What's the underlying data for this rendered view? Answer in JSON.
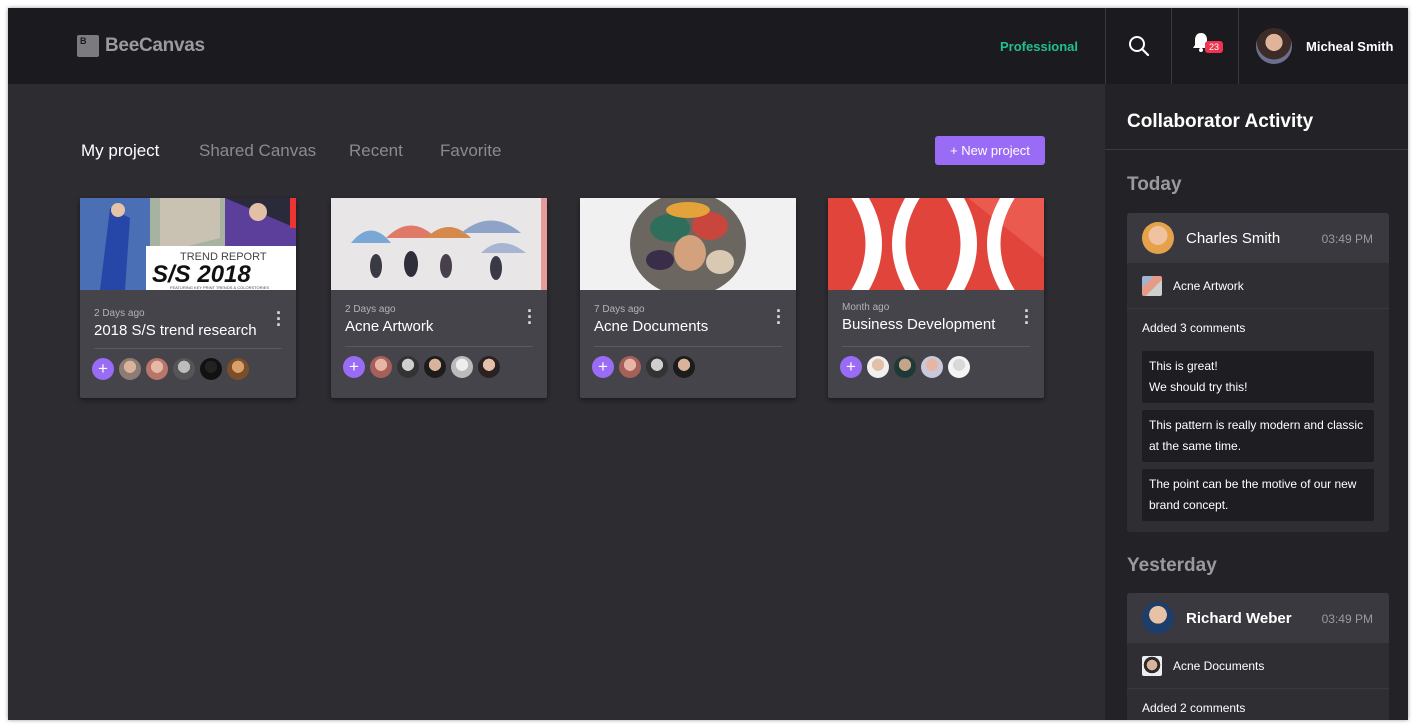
{
  "header": {
    "logo_text": "BeeCanvas",
    "logo_letter": "B",
    "plan": "Professional",
    "notification_count": "23",
    "user_name": "Micheal Smith"
  },
  "tabs": [
    {
      "label": "My project",
      "active": true
    },
    {
      "label": "Shared Canvas",
      "active": false
    },
    {
      "label": "Recent",
      "active": false
    },
    {
      "label": "Favorite",
      "active": false
    }
  ],
  "new_project_label": "+ New project",
  "projects": [
    {
      "time": "2 Days ago",
      "title": "2018 S/S trend research",
      "thumb_text_1": "TREND REPORT",
      "thumb_text_2": "S/S 2018",
      "thumb_text_3": "FEATURING KEY PRINT TRENDS & COLORSTORIES"
    },
    {
      "time": "2 Days ago",
      "title": "Acne Artwork"
    },
    {
      "time": "7 Days ago",
      "title": "Acne Documents"
    },
    {
      "time": "Month ago",
      "title": "Business Development"
    }
  ],
  "panel": {
    "title": "Collaborator Activity",
    "today_label": "Today",
    "yesterday_label": "Yesterday",
    "activities": [
      {
        "name": "Charles Smith",
        "time": "03:49 PM",
        "file": "Acne Artwork",
        "summary": "Added 3 comments",
        "comments": [
          "This is great!\nWe should try this!",
          "This pattern is really modern and classic at the same time.",
          "The point can be the motive of our new brand concept."
        ]
      },
      {
        "name": "Richard Weber",
        "time": "03:49 PM",
        "file": "Acne Documents",
        "summary": "Added 2 comments"
      }
    ]
  },
  "colors": {
    "accent": "#9a6cf6",
    "plan_green": "#21c08b",
    "badge_red": "#f0334f",
    "background": "#2d2c31",
    "header": "#1b1a1e"
  }
}
